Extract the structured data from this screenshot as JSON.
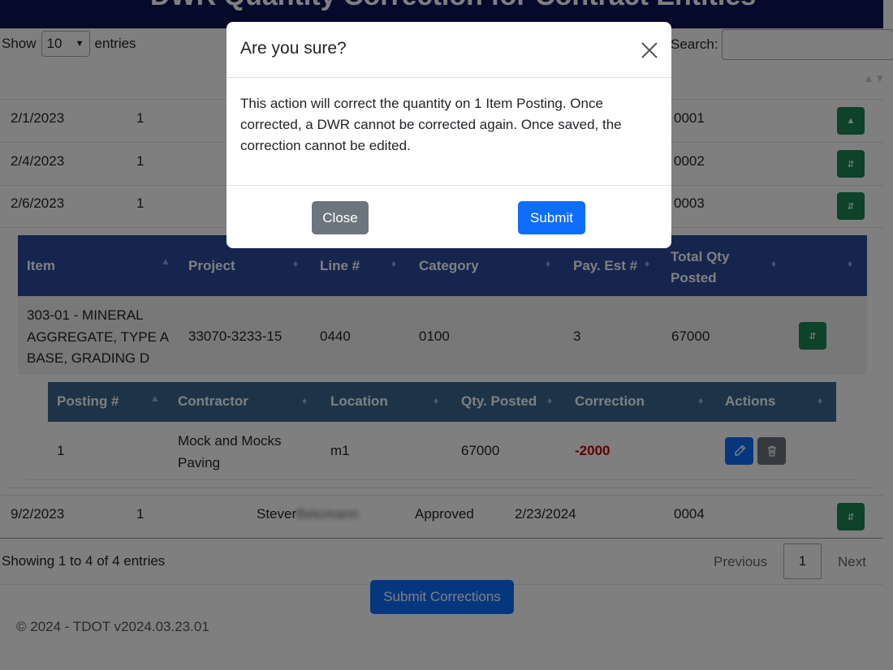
{
  "page": {
    "title": "DWR Quantity Correction for Contract Entities",
    "length_label_pre": "Show",
    "length_value": "10",
    "length_label_post": "entries",
    "search_label": "Search:",
    "sort_glyph": "▲▼"
  },
  "dwr_rows": [
    {
      "date": "2/1/2023",
      "num": "1",
      "id": "0001",
      "btn_icon": "expand-icon"
    },
    {
      "date": "2/4/2023",
      "num": "1",
      "id": "0002",
      "btn_icon": "expand-icon"
    },
    {
      "date": "2/6/2023",
      "num": "1",
      "id": "0003",
      "btn_icon": "expand-icon"
    }
  ],
  "item_table": {
    "headers": [
      "Item",
      "Project",
      "Line #",
      "Category",
      "Pay. Est #",
      "Total Qty Posted"
    ],
    "row": {
      "item": "303-01 - MINERAL AGGREGATE, TYPE A BASE, GRADING D",
      "project": "33070-3233-15",
      "line": "0440",
      "category": "0100",
      "pay_est": "3",
      "total_qty": "67000"
    }
  },
  "posting_table": {
    "headers": [
      "Posting #",
      "Contractor",
      "Location",
      "Qty. Posted",
      "Correction",
      "Actions"
    ],
    "row": {
      "posting": "1",
      "contractor": "Mock and Mocks Paving",
      "location": "m1",
      "qty_posted": "67000",
      "correction": "-2000"
    }
  },
  "last_row": {
    "date": "9/2/2023",
    "num": "1",
    "name": "Stever",
    "name_blurred": "Betcmann",
    "status": "Approved",
    "approved_date": "2/23/2024",
    "id": "0004"
  },
  "pagination": {
    "info": "Showing 1 to 4 of 4 entries",
    "previous": "Previous",
    "current": "1",
    "next": "Next"
  },
  "submit_corrections_label": "Submit Corrections",
  "footer": "© 2024 - TDOT v2024.03.23.01",
  "modal": {
    "title": "Are you sure?",
    "body": "This action will correct the quantity on 1 Item Posting. Once corrected, a DWR cannot be corrected again. Once saved, the correction cannot be edited.",
    "close_label": "Close",
    "submit_label": "Submit"
  },
  "colors": {
    "title_bar": "#0b1557",
    "item_header": "#2c4a9c",
    "posting_header": "#3a6991",
    "green": "#198754",
    "primary": "#0d6efd",
    "secondary": "#6c757d",
    "correction": "#c00000"
  }
}
